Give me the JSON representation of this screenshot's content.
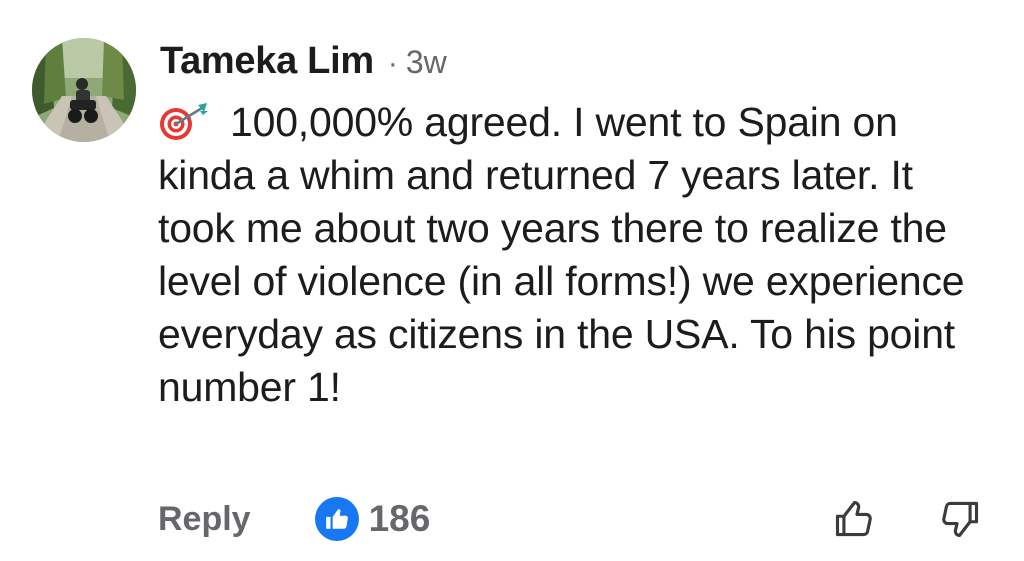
{
  "comment": {
    "author": "Tameka Lim",
    "separator": "·",
    "time": "3w",
    "emoji_icon": "direct-hit-target-icon",
    "text": "100,000% agreed. I went to Spain on kinda a whim and returned 7 years later. It took me about two years there to realize the level of violence (in all forms!) we experience everyday as citizens in the USA. To his point number 1!",
    "avatar_icon": "motorcycle-rider-avatar"
  },
  "actions": {
    "reply_label": "Reply",
    "like_icon": "thumbs-up-icon",
    "like_count": "186",
    "upvote_icon": "thumbs-up-outline-icon",
    "downvote_icon": "thumbs-down-outline-icon"
  },
  "colors": {
    "text": "#1c1c1e",
    "secondary": "#65676b",
    "like_blue": "#1877f2"
  }
}
